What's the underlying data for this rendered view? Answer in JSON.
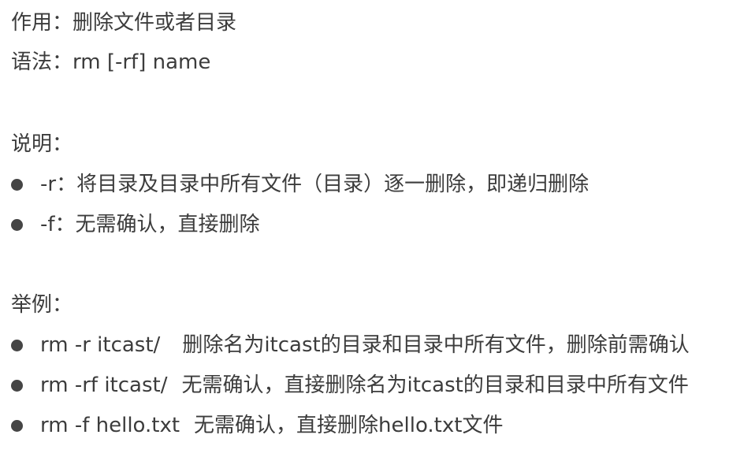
{
  "purpose": "作用：删除文件或者目录",
  "syntax": "语法：rm [-rf] name",
  "notes_heading": "说明：",
  "notes": [
    "-r：将目录及目录中所有文件（目录）逐一删除，即递归删除",
    "-f：无需确认，直接删除"
  ],
  "examples_heading": "举例：",
  "examples": [
    {
      "cmd": "rm -r itcast/",
      "desc": "删除名为itcast的目录和目录中所有文件，删除前需确认"
    },
    {
      "cmd": "rm -rf itcast/",
      "desc": "无需确认，直接删除名为itcast的目录和目录中所有文件"
    },
    {
      "cmd": "rm -f hello.txt",
      "desc": "无需确认，直接删除hello.txt文件"
    }
  ]
}
